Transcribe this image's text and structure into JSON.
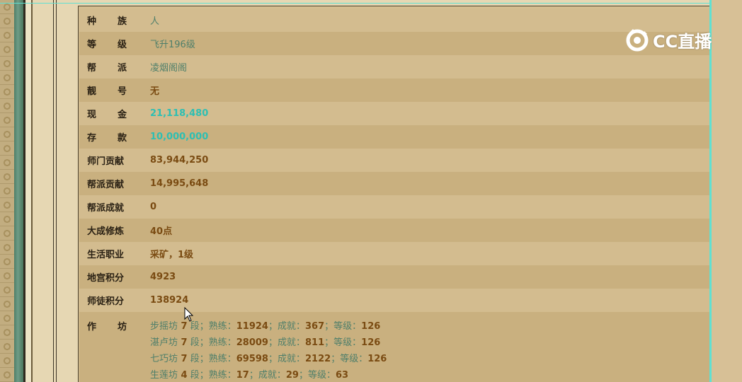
{
  "profile": {
    "rows": [
      {
        "label": "种族",
        "value": "人",
        "style": "plain"
      },
      {
        "label": "等级",
        "value": "飞升196级",
        "style": "plain"
      },
      {
        "label": "帮派",
        "value": "凌烟阁阁",
        "style": "plain"
      },
      {
        "label": "靓号",
        "value": "无",
        "style": "brown"
      },
      {
        "label": "现金",
        "value": "21,118,480",
        "style": "cyan"
      },
      {
        "label": "存款",
        "value": "10,000,000",
        "style": "cyan"
      },
      {
        "label": "师门贡献",
        "value": "83,944,250",
        "style": "brown"
      },
      {
        "label": "帮派贡献",
        "value": "14,995,648",
        "style": "brown"
      },
      {
        "label": "帮派成就",
        "value": "0",
        "style": "brown"
      },
      {
        "label": "大成修炼",
        "value": "40点",
        "style": "brown"
      },
      {
        "label": "生活职业",
        "value": "采矿，1级",
        "style": "brown"
      },
      {
        "label": "地宫积分",
        "value": "4923",
        "style": "brown"
      },
      {
        "label": "师徒积分",
        "value": "138924",
        "style": "brown"
      }
    ],
    "workshop": {
      "label": "作坊",
      "lines": [
        {
          "name": "步摇坊",
          "duan": "7",
          "shulian": "11924",
          "chengjiu": "367",
          "dengji": "126"
        },
        {
          "name": "湛卢坊",
          "duan": "7",
          "shulian": "28009",
          "chengjiu": "811",
          "dengji": "126"
        },
        {
          "name": "七巧坊",
          "duan": "7",
          "shulian": "69598",
          "chengjiu": "2122",
          "dengji": "126"
        },
        {
          "name": "生莲坊",
          "duan": "4",
          "shulian": "17",
          "chengjiu": "29",
          "dengji": "63"
        }
      ],
      "text_duan": "段；熟练：",
      "text_chengjiu": "；成就：",
      "text_dengji": "；等级："
    }
  },
  "watermark": {
    "text": "CC直播",
    "icon": "cc-logo-icon"
  },
  "colors": {
    "plain": "#4f7f6a",
    "cyan": "#2dbfb3",
    "brown": "#7a4b12",
    "accent_line": "#5fe1d3"
  }
}
